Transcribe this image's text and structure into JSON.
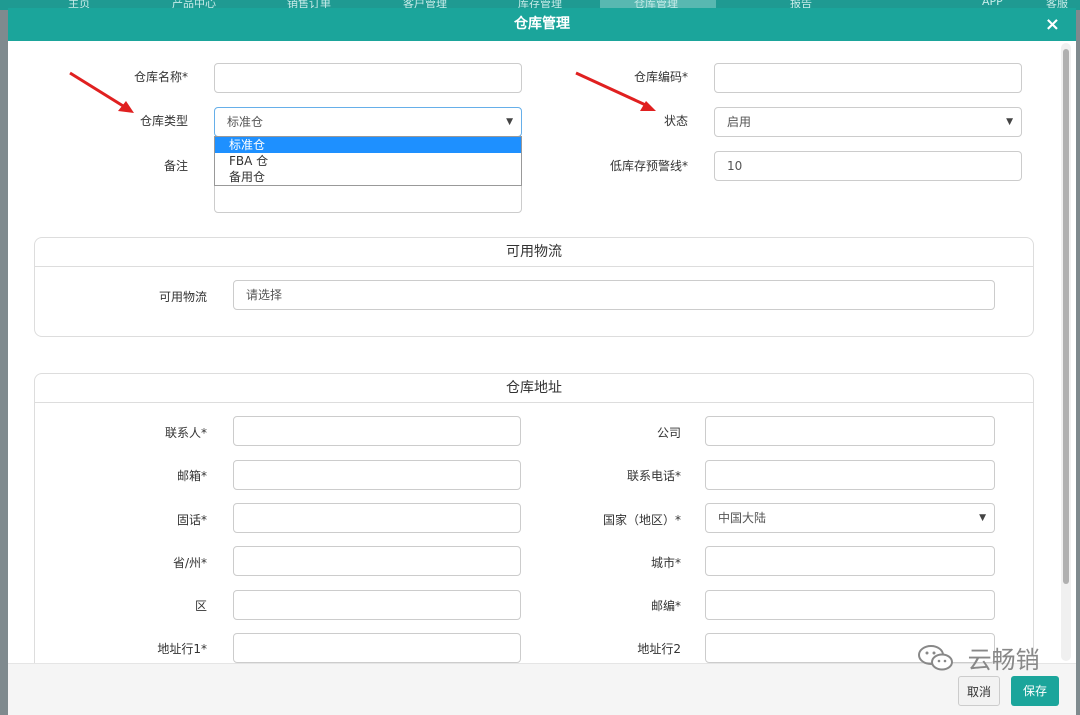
{
  "topnav": {
    "items": [
      "主页",
      "产品中心",
      "销售订单",
      "客户管理",
      "库存管理",
      "仓库管理",
      "报告",
      "APP",
      "客服"
    ]
  },
  "modal": {
    "title": "仓库管理",
    "close_icon": "×"
  },
  "form": {
    "warehouse_name_label": "仓库名称*",
    "warehouse_name_value": "",
    "warehouse_code_label": "仓库编码*",
    "warehouse_code_value": "",
    "warehouse_type_label": "仓库类型",
    "warehouse_type_value": "标准仓",
    "warehouse_type_options": [
      "标准仓",
      "FBA 仓",
      "备用仓"
    ],
    "status_label": "状态",
    "status_value": "启用",
    "note_label": "备注",
    "note_value": "",
    "low_stock_label": "低库存预警线*",
    "low_stock_value": "10"
  },
  "logistics": {
    "title": "可用物流",
    "label": "可用物流",
    "placeholder": "请选择"
  },
  "address": {
    "title": "仓库地址",
    "contact_label": "联系人*",
    "company_label": "公司",
    "email_label": "邮箱*",
    "phone_label": "联系电话*",
    "landline_label": "固话*",
    "country_label": "国家（地区）*",
    "country_value": "中国大陆",
    "province_label": "省/州*",
    "city_label": "城市*",
    "district_label": "区",
    "zip_label": "邮编*",
    "address1_label": "地址行1*",
    "address2_label": "地址行2"
  },
  "footer": {
    "cancel_label": "取消",
    "save_label": "保存"
  },
  "watermark": {
    "text": "云畅销"
  },
  "colors": {
    "brand": "#1ba59b",
    "dropdown_selected": "#1e90ff",
    "annotation_arrow": "#e02020"
  },
  "icons": {
    "close": "close-icon",
    "select_arrow": "chevron-down-icon",
    "annotation": "red-arrow-icon",
    "watermark": "wechat-icon"
  }
}
